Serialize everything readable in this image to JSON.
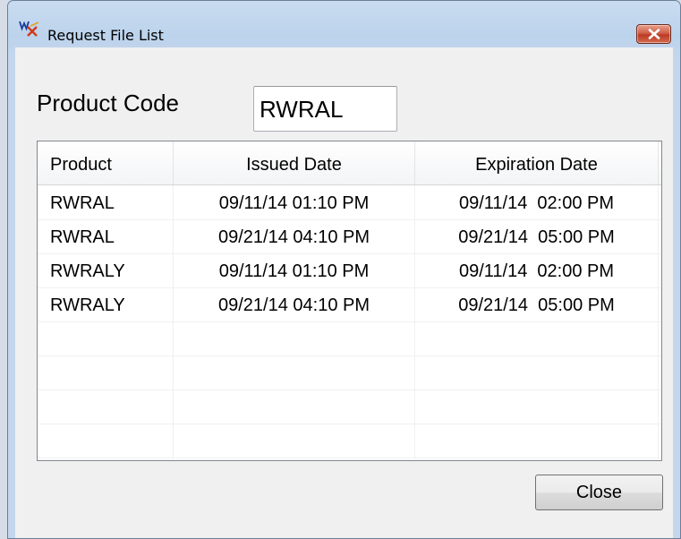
{
  "window": {
    "title": "Request File List",
    "app_icon": "wx-app-icon",
    "close_icon": "close-x-icon"
  },
  "product_code": {
    "label": "Product Code",
    "value": "RWRAL"
  },
  "table": {
    "columns": [
      "Product",
      "Issued Date",
      "Expiration Date"
    ],
    "rows": [
      [
        "RWRAL",
        "09/11/14 01:10 PM",
        "09/11/14  02:00 PM"
      ],
      [
        "RWRAL",
        "09/21/14 04:10 PM",
        "09/21/14  05:00 PM"
      ],
      [
        "RWRALY",
        "09/11/14 01:10 PM",
        "09/11/14  02:00 PM"
      ],
      [
        "RWRALY",
        "09/21/14 04:10 PM",
        "09/21/14  05:00 PM"
      ],
      [
        "",
        "",
        ""
      ],
      [
        "",
        "",
        ""
      ],
      [
        "",
        "",
        ""
      ],
      [
        "",
        "",
        ""
      ]
    ]
  },
  "buttons": {
    "close": "Close"
  },
  "colors": {
    "close_x": "#c8452f",
    "title_bar": "#bfd5ed",
    "client": "#f0f0f0"
  }
}
